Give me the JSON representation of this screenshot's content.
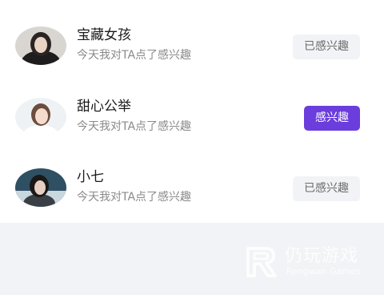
{
  "list": {
    "items": [
      {
        "name": "宝藏女孩",
        "subtitle": "今天我对TA点了感兴趣",
        "button_label": "已感兴趣",
        "state": "done"
      },
      {
        "name": "甜心公举",
        "subtitle": "今天我对TA点了感兴趣",
        "button_label": "感兴趣",
        "state": "active"
      },
      {
        "name": "小七",
        "subtitle": "今天我对TA点了感兴趣",
        "button_label": "已感兴趣",
        "state": "done"
      }
    ]
  },
  "watermark": {
    "title": "仍玩游戏",
    "subtitle": "Rengwan Games"
  },
  "colors": {
    "accent": "#6a3ddc",
    "page_background": "#f2f3f6",
    "done_button_bg": "#f2f3f6",
    "done_button_text": "#6b6b6b"
  }
}
